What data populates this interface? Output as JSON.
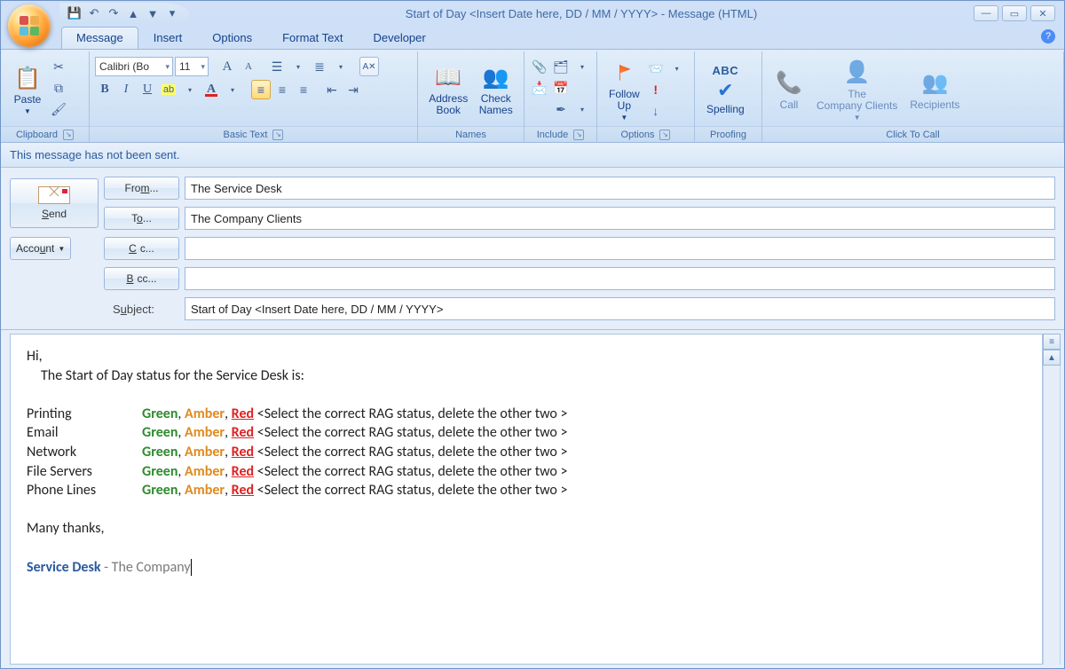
{
  "window": {
    "title": "Start of Day <Insert Date here, DD / MM / YYYY>  -  Message (HTML)"
  },
  "qat": {
    "save": "💾",
    "undo": "↶",
    "redo": "↷",
    "prev": "▲",
    "next": "▼",
    "custom": "▾"
  },
  "tabs": {
    "message": "Message",
    "insert": "Insert",
    "options": "Options",
    "format": "Format Text",
    "developer": "Developer"
  },
  "ribbon": {
    "clipboard": {
      "title": "Clipboard",
      "paste": "Paste"
    },
    "basictext": {
      "title": "Basic Text",
      "font_name": "Calibri (Bo",
      "font_size": "11"
    },
    "names": {
      "title": "Names",
      "address": "Address Book",
      "check": "Check Names"
    },
    "include": {
      "title": "Include"
    },
    "options": {
      "title": "Options",
      "follow": "Follow Up"
    },
    "proofing": {
      "title": "Proofing",
      "spelling": "Spelling",
      "abc": "ABC"
    },
    "clicktocall": {
      "title": "Click To Call",
      "call": "Call",
      "company": "The Company Clients",
      "recipients": "Recipients"
    }
  },
  "infobar": "This message has not been sent.",
  "header": {
    "send": "Send",
    "account": "Account",
    "from_btn": "From...",
    "to_btn": "To...",
    "cc_btn": "Cc...",
    "bcc_btn": "Bcc...",
    "subject_lbl": "Subject:",
    "from_val": "The Service Desk",
    "to_val": "The Company Clients",
    "cc_val": "",
    "bcc_val": "",
    "subject_val": "Start of Day <Insert Date here, DD / MM / YYYY>"
  },
  "body": {
    "hi": "Hi,",
    "intro": "The Start of Day status for the Service Desk is:",
    "services": [
      "Printing",
      "Email",
      "Network",
      "File Servers",
      "Phone Lines"
    ],
    "green": "Green",
    "amber": "Amber",
    "red": "Red",
    "instr": "<Select the correct RAG status, delete the other two >",
    "thanks": "Many thanks,",
    "sig_bold": "Service Desk",
    "sig_rest": " - The Company"
  }
}
